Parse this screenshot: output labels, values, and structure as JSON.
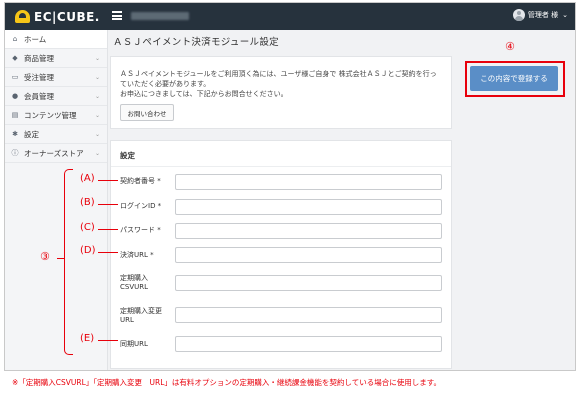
{
  "app": {
    "logo": "EC|CUBE."
  },
  "header": {
    "user_label": "管理者 様",
    "caret": "⌄"
  },
  "sidebar": {
    "items": [
      {
        "icon": "home-icon",
        "glyph": "⌂",
        "label": "ホーム",
        "chev": ""
      },
      {
        "icon": "tag-icon",
        "glyph": "🏷",
        "label": "商品管理",
        "chev": "⌄"
      },
      {
        "icon": "cart-icon",
        "glyph": "🛒",
        "label": "受注管理",
        "chev": "⌄"
      },
      {
        "icon": "user-icon",
        "glyph": "👤",
        "label": "会員管理",
        "chev": "⌄"
      },
      {
        "icon": "file-icon",
        "glyph": "▤",
        "label": "コンテンツ管理",
        "chev": "⌄"
      },
      {
        "icon": "gear-icon",
        "glyph": "⚙",
        "label": "設定",
        "chev": "⌄"
      },
      {
        "icon": "info-icon",
        "glyph": "ⓘ",
        "label": "オーナーズストア",
        "chev": "⌄"
      }
    ]
  },
  "main": {
    "title": "ＡＳＪペイメント決済モジュール設定",
    "notice": {
      "text": "ＡＳＪペイメントモジュールをご利用頂く為には、ユーザ様ご自身で 株式会社ＡＳＪとご契約を行っ\nていただく必要があります。\nお申込につきましては、下記からお問合せください。",
      "button": "お問い合わせ"
    },
    "settings": {
      "title": "設定",
      "fields": [
        {
          "label": "契約者番号 *",
          "value": ""
        },
        {
          "label": "ログインID *",
          "value": ""
        },
        {
          "label": "パスワード *",
          "value": ""
        },
        {
          "label": "決済URL *",
          "value": ""
        },
        {
          "label": "定期購入\nCSVURL",
          "value": ""
        },
        {
          "label": "定期購入変更\nURL",
          "value": ""
        },
        {
          "label": "同期URL",
          "value": ""
        }
      ]
    },
    "register_button": "この内容で登録する"
  },
  "annotations": {
    "circled": [
      "④",
      "③"
    ],
    "letters": [
      "(A)",
      "(B)",
      "(C)",
      "(D)",
      "(E)"
    ],
    "footnote": "※「定期購入CSVURL」「定期購入変更　URL」は有料オプションの定期購入・継続課金機能を契約している場合に使用します。"
  },
  "colors": {
    "accent": "#5a8ec7",
    "annotation": "#e8000b",
    "header": "#26323d"
  }
}
